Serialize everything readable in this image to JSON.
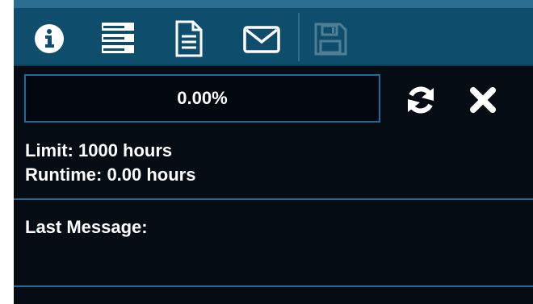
{
  "toolbar": {
    "icons": [
      "info-icon",
      "server-icon",
      "document-icon",
      "envelope-icon",
      "save-icon"
    ],
    "save_disabled": true
  },
  "progress": {
    "text": "0.00%",
    "fraction": 0.0
  },
  "actions": {
    "icons": [
      "refresh-icon",
      "close-icon"
    ]
  },
  "info": {
    "limit_text": "Limit:  1000 hours",
    "runtime_text": "Runtime:  0.00 hours"
  },
  "message": {
    "label": "Last Message:",
    "value": ""
  },
  "colors": {
    "toolbar_bg": "#0f4d6d",
    "panel_bg": "#050c14",
    "accent": "#1b6c9b",
    "icon_white": "#ffffff",
    "icon_disabled": "#4f7f95"
  }
}
